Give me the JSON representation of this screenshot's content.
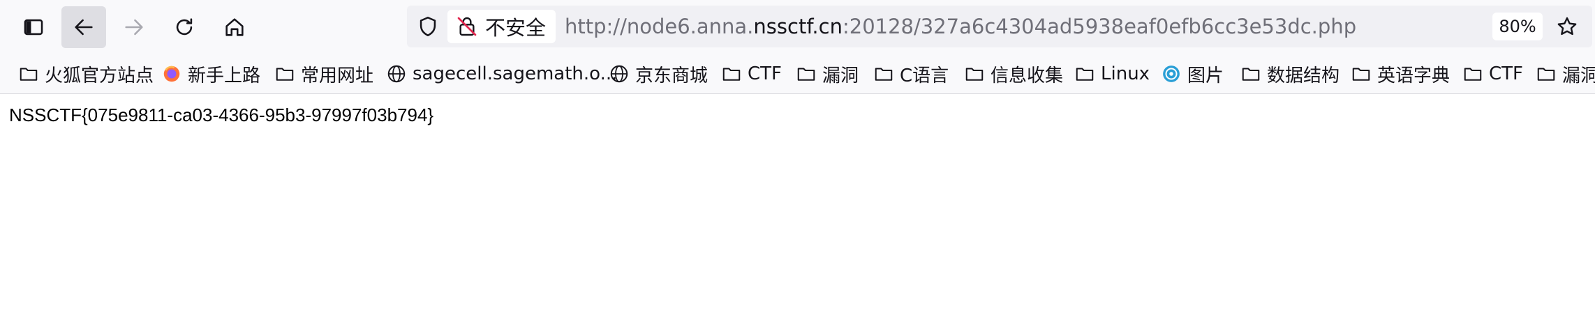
{
  "toolbar": {
    "sidebar_icon": "sidebar-icon",
    "back_icon": "back-arrow-icon",
    "forward_icon": "forward-arrow-icon",
    "reload_icon": "reload-icon",
    "home_icon": "home-icon"
  },
  "urlbar": {
    "security_label": "不安全",
    "url_prefix": "http://node6.anna.",
    "url_host": "nssctf.cn",
    "url_suffix": ":20128/327a6c4304ad5938eaf0efb6cc3e53dc.php",
    "zoom": "80%",
    "bookmark_star_icon": "star-icon",
    "tracking_shield_icon": "shield-icon",
    "insecure_lock_icon": "insecure-lock-icon"
  },
  "bookmarks": [
    {
      "label": "火狐官方站点",
      "icon": "folder-icon"
    },
    {
      "label": "新手上路",
      "icon": "firefox-icon"
    },
    {
      "label": "常用网址",
      "icon": "folder-icon"
    },
    {
      "label": "sagecell.sagemath.o...",
      "icon": "globe-icon"
    },
    {
      "label": "京东商城",
      "icon": "globe-icon"
    },
    {
      "label": "CTF",
      "icon": "folder-icon"
    },
    {
      "label": "漏洞",
      "icon": "folder-icon"
    },
    {
      "label": "C语言",
      "icon": "folder-icon"
    },
    {
      "label": "信息收集",
      "icon": "folder-icon"
    },
    {
      "label": "Linux",
      "icon": "folder-icon"
    },
    {
      "label": "图片",
      "icon": "image-site-icon"
    },
    {
      "label": "数据结构",
      "icon": "folder-icon"
    },
    {
      "label": "英语字典",
      "icon": "folder-icon"
    },
    {
      "label": "CTF",
      "icon": "folder-icon"
    },
    {
      "label": "漏洞",
      "icon": "folder-icon"
    }
  ],
  "page": {
    "text": "NSSCTF{075e9811-ca03-4366-95b3-97997f03b794}"
  }
}
